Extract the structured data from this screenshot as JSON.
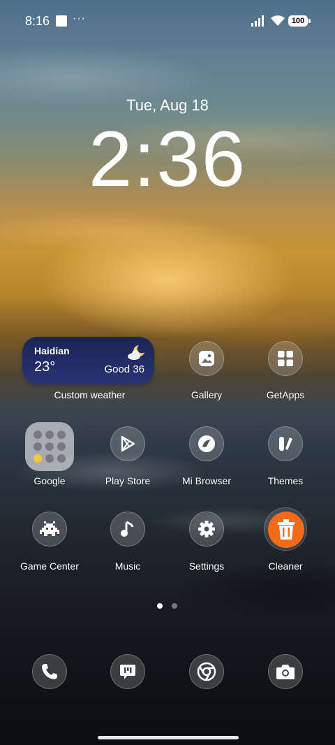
{
  "status_bar": {
    "time": "8:16",
    "dots": "···",
    "battery": "100"
  },
  "lock": {
    "date": "Tue, Aug 18",
    "time": "2:36"
  },
  "weather": {
    "city": "Haidian",
    "temperature": "23°",
    "air_quality": "Good 36",
    "label": "Custom weather",
    "colors": {
      "background": "#1b2456"
    }
  },
  "apps": {
    "gallery": "Gallery",
    "getapps": "GetApps",
    "google": "Google",
    "play_store": "Play Store",
    "mi_browser": "Mi Browser",
    "themes": "Themes",
    "game_center": "Game Center",
    "music": "Music",
    "settings": "Settings",
    "cleaner": "Cleaner"
  },
  "cleaner_color": "#f36b17",
  "pager": {
    "pages": 2,
    "current": 1
  },
  "dock": [
    "phone-icon",
    "messages-icon",
    "chrome-icon",
    "camera-icon"
  ]
}
